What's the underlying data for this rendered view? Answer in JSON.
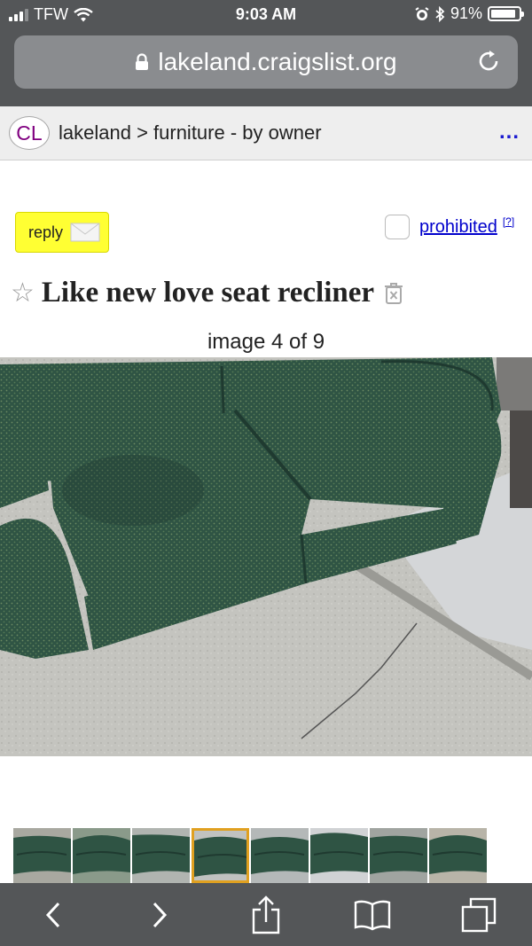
{
  "status": {
    "carrier": "TFW",
    "time": "9:03 AM",
    "battery": "91%",
    "battery_level": 0.91
  },
  "browser": {
    "url": "lakeland.craigslist.org"
  },
  "cl": {
    "logo": "CL",
    "breadcrumb": "lakeland > furniture - by owner",
    "menu": "..."
  },
  "post": {
    "reply_label": "reply",
    "prohibited_label": "prohibited",
    "prohibited_help": "[?]",
    "title": "Like new love seat recliner",
    "image_counter": "image 4 of 9",
    "thumbnail_count": 9,
    "active_thumbnail": 4
  },
  "icons": {
    "lock": "lock-icon",
    "reload": "reload-icon",
    "envelope": "envelope-icon",
    "star": "star-icon",
    "trash": "trash-icon",
    "back": "back-icon",
    "forward": "forward-icon",
    "share": "share-icon",
    "bookmarks": "bookmarks-icon",
    "tabs": "tabs-icon"
  },
  "colors": {
    "reply_bg": "#ffff33",
    "sofa": "#2f5444",
    "concrete": "#c4c4bf",
    "active_thumb": "#e0a020"
  }
}
